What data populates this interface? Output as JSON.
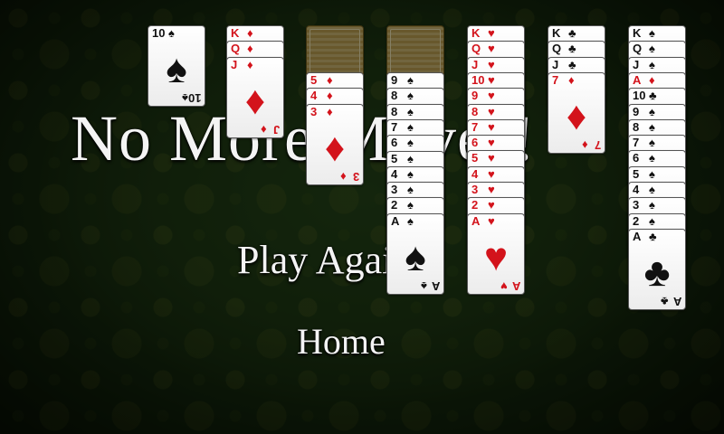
{
  "dialog": {
    "title": "No More Moves!",
    "play_again": "Play Again",
    "home": "Home"
  },
  "tableau": [
    {
      "cards": [
        {
          "rank": "10",
          "suit": "♠",
          "color": "black"
        }
      ]
    },
    {
      "cards": [
        {
          "rank": "K",
          "suit": "♦",
          "color": "red"
        },
        {
          "rank": "Q",
          "suit": "♦",
          "color": "red"
        },
        {
          "rank": "J",
          "suit": "♦",
          "color": "red"
        }
      ]
    },
    {
      "backs": 1,
      "cards": [
        {
          "rank": "5",
          "suit": "♦",
          "color": "red"
        },
        {
          "rank": "4",
          "suit": "♦",
          "color": "red"
        },
        {
          "rank": "3",
          "suit": "♦",
          "color": "red"
        }
      ]
    },
    {
      "backs": 1,
      "cards": [
        {
          "rank": "9",
          "suit": "♠",
          "color": "black"
        },
        {
          "rank": "8",
          "suit": "♠",
          "color": "black"
        },
        {
          "rank": "8",
          "suit": "♠",
          "color": "black"
        },
        {
          "rank": "7",
          "suit": "♠",
          "color": "black"
        },
        {
          "rank": "6",
          "suit": "♠",
          "color": "black"
        },
        {
          "rank": "5",
          "suit": "♠",
          "color": "black"
        },
        {
          "rank": "4",
          "suit": "♠",
          "color": "black"
        },
        {
          "rank": "3",
          "suit": "♠",
          "color": "black"
        },
        {
          "rank": "2",
          "suit": "♠",
          "color": "black"
        },
        {
          "rank": "A",
          "suit": "♠",
          "color": "black"
        }
      ]
    },
    {
      "cards": [
        {
          "rank": "K",
          "suit": "♥",
          "color": "red"
        },
        {
          "rank": "Q",
          "suit": "♥",
          "color": "red"
        },
        {
          "rank": "J",
          "suit": "♥",
          "color": "red"
        },
        {
          "rank": "10",
          "suit": "♥",
          "color": "red"
        },
        {
          "rank": "9",
          "suit": "♥",
          "color": "red"
        },
        {
          "rank": "8",
          "suit": "♥",
          "color": "red"
        },
        {
          "rank": "7",
          "suit": "♥",
          "color": "red"
        },
        {
          "rank": "6",
          "suit": "♥",
          "color": "red"
        },
        {
          "rank": "5",
          "suit": "♥",
          "color": "red"
        },
        {
          "rank": "4",
          "suit": "♥",
          "color": "red"
        },
        {
          "rank": "3",
          "suit": "♥",
          "color": "red"
        },
        {
          "rank": "2",
          "suit": "♥",
          "color": "red"
        },
        {
          "rank": "A",
          "suit": "♥",
          "color": "red"
        }
      ]
    },
    {
      "cards": [
        {
          "rank": "K",
          "suit": "♣",
          "color": "black"
        },
        {
          "rank": "Q",
          "suit": "♣",
          "color": "black"
        },
        {
          "rank": "J",
          "suit": "♣",
          "color": "black"
        },
        {
          "rank": "7",
          "suit": "♦",
          "color": "red"
        }
      ]
    },
    {
      "cards": [
        {
          "rank": "K",
          "suit": "♠",
          "color": "black"
        },
        {
          "rank": "Q",
          "suit": "♠",
          "color": "black"
        },
        {
          "rank": "J",
          "suit": "♠",
          "color": "black"
        },
        {
          "rank": "A",
          "suit": "♦",
          "color": "red"
        },
        {
          "rank": "10",
          "suit": "♣",
          "color": "black"
        },
        {
          "rank": "9",
          "suit": "♠",
          "color": "black"
        },
        {
          "rank": "8",
          "suit": "♠",
          "color": "black"
        },
        {
          "rank": "7",
          "suit": "♠",
          "color": "black"
        },
        {
          "rank": "6",
          "suit": "♠",
          "color": "black"
        },
        {
          "rank": "5",
          "suit": "♠",
          "color": "black"
        },
        {
          "rank": "4",
          "suit": "♠",
          "color": "black"
        },
        {
          "rank": "3",
          "suit": "♠",
          "color": "black"
        },
        {
          "rank": "2",
          "suit": "♠",
          "color": "black"
        },
        {
          "rank": "A",
          "suit": "♣",
          "color": "black"
        }
      ]
    }
  ],
  "colors": {
    "felt": "#1c3612",
    "red_suit": "#d3131b",
    "black_suit": "#111111",
    "text": "#f4f4f4"
  }
}
